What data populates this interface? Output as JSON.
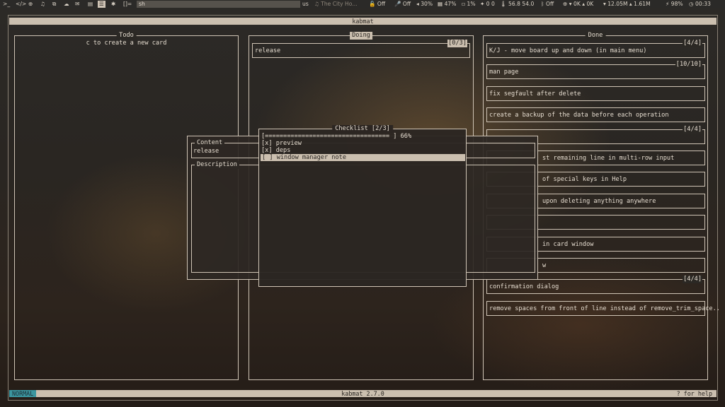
{
  "topbar": {
    "icons": [
      "terminal-icon",
      "code-icon",
      "globe-icon",
      "music-icon",
      "files-icon",
      "chat-icon",
      "mail-icon"
    ],
    "active_workspace": "☰",
    "asterisk": "✱",
    "layout": "[]=",
    "window_title": "sh",
    "keyboard": "us",
    "media": "♫ The City Ho...",
    "lock_status": "🔓 Off",
    "mic_status": "🎤 Off",
    "volume": "◂ 30%",
    "memory": "▦ 47%",
    "cpu": "▫ 1%",
    "updates": "✦ 0 0",
    "temp": "🌡 56.8 54.0",
    "bluetooth": "ᛒ Off",
    "net_speed_a": "⊕ ▾ 0K ▴ 0K",
    "net_speed_b": "▾ 12.05M ▴ 1.61M",
    "battery": "⚡ 98%",
    "clock": "◷ 00:33"
  },
  "app": {
    "title": "kabmat",
    "mode": "NORMAL",
    "version": "kabmat 2.7.0",
    "help_hint": "? for help"
  },
  "columns": {
    "todo": {
      "title": "Todo",
      "hint": "c to create a new card"
    },
    "doing": {
      "title": "Doing",
      "cards": [
        {
          "text": "release",
          "count": "[0/3]"
        }
      ]
    },
    "done": {
      "title": "Done",
      "cards": [
        {
          "text": "K/J - move board up and down (in main menu)",
          "count": "[4/4]"
        },
        {
          "text": "man page",
          "count": "[10/10]"
        },
        {
          "text": "fix segfault after delete",
          "count": ""
        },
        {
          "text": "create a backup of the data before each operation",
          "count": ""
        },
        {
          "text": "",
          "count": "[4/4]"
        },
        {
          "text": "st remaining line in multi-row input",
          "count": ""
        },
        {
          "text": "of special keys in Help",
          "count": ""
        },
        {
          "text": " upon deleting anything anywhere",
          "count": ""
        },
        {
          "text": "",
          "count": ""
        },
        {
          "text": " in card window",
          "count": ""
        },
        {
          "text": "w",
          "count": ""
        },
        {
          "text": "confirmation dialog",
          "count": "[4/4]"
        },
        {
          "text": "remove spaces from front of line instead of remove_trim_space..",
          "count": ""
        }
      ]
    }
  },
  "card_window": {
    "content_label": "Content",
    "content_value": "release",
    "description_label": "Description"
  },
  "checklist": {
    "title": "Checklist [2/3]",
    "progress_text": "[==================================        ]  66%",
    "progress": 0.66,
    "items": [
      {
        "text": "[x] preview",
        "checked": true
      },
      {
        "text": "[x] deps",
        "checked": true
      },
      {
        "text": "[ ] window manager note",
        "checked": false
      }
    ]
  }
}
